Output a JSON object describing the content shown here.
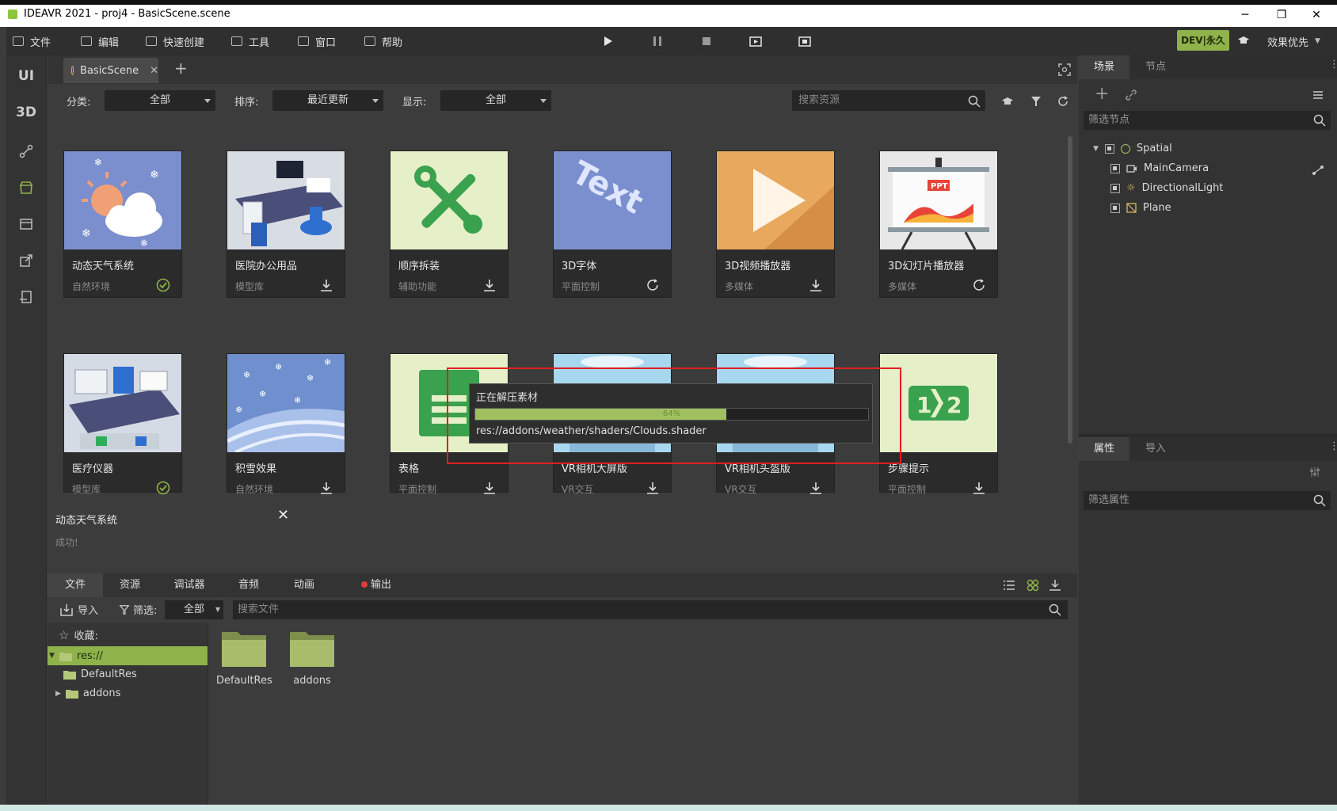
{
  "window": {
    "title": "IDEAVR 2021 - proj4 - BasicScene.scene",
    "controls": [
      "─",
      "❐",
      "✕"
    ]
  },
  "menu": {
    "items": [
      {
        "label": "文件",
        "icon": "folder-icon"
      },
      {
        "label": "编辑",
        "icon": "crop-icon"
      },
      {
        "label": "快速创建",
        "icon": "edit-icon"
      },
      {
        "label": "工具",
        "icon": "toolbox-icon"
      },
      {
        "label": "窗口",
        "icon": "window-icon"
      },
      {
        "label": "帮助",
        "icon": "book-icon"
      }
    ],
    "dev_badge": "DEV|永久",
    "quality": "效果优先"
  },
  "leftbar": {
    "ui": "UI",
    "threed": "3D"
  },
  "scene_tab": {
    "label": "BasicScene",
    "close": "✕",
    "add": "+"
  },
  "filters": {
    "category_label": "分类:",
    "category_value": "全部",
    "sort_label": "排序:",
    "sort_value": "最近更新",
    "display_label": "显示:",
    "display_value": "全部",
    "search_placeholder": "搜索资源"
  },
  "assets": [
    {
      "name": "动态天气系统",
      "category": "自然环境",
      "status": "installed"
    },
    {
      "name": "医院办公用品",
      "category": "模型库",
      "status": "download"
    },
    {
      "name": "顺序拆装",
      "category": "辅助功能",
      "status": "download"
    },
    {
      "name": "3D字体",
      "category": "平面控制",
      "status": "update"
    },
    {
      "name": "3D视频播放器",
      "category": "多媒体",
      "status": "download"
    },
    {
      "name": "3D幻灯片播放器",
      "category": "多媒体",
      "status": "update"
    },
    {
      "name": "医疗仪器",
      "category": "模型库",
      "status": "installed"
    },
    {
      "name": "积雪效果",
      "category": "自然环境",
      "status": "download"
    },
    {
      "name": "表格",
      "category": "平面控制",
      "status": "download"
    },
    {
      "name": "VR相机大屏版",
      "category": "VR交互",
      "status": "download"
    },
    {
      "name": "VR相机头盔版",
      "category": "VR交互",
      "status": "download"
    },
    {
      "name": "步骤提示",
      "category": "平面控制",
      "status": "download"
    }
  ],
  "thumb_text": {
    "text_art": "Text",
    "ppt": "PPT",
    "steps_left": "1",
    "steps_right": "2"
  },
  "notification": {
    "title": "动态天气系统",
    "message": "成功!",
    "close": "✕"
  },
  "progress": {
    "title": "正在解压素材",
    "percent_label": "64%",
    "fraction": 0.64,
    "path": "res://addons/weather/shaders/Clouds.shader"
  },
  "bottom": {
    "tabs": [
      "文件",
      "资源",
      "调试器",
      "音频",
      "动画",
      "输出"
    ],
    "import_label": "导入",
    "filter_label": "筛选:",
    "filter_value": "全部",
    "search_placeholder": "搜索文件",
    "favorites": "收藏:",
    "tree": [
      "res://",
      "DefaultRes",
      "addons"
    ],
    "folders": [
      "DefaultRes",
      "addons"
    ]
  },
  "right": {
    "tabs": [
      "场景",
      "节点"
    ],
    "filter_nodes": "筛选节点",
    "nodes": [
      "Spatial",
      "MainCamera",
      "DirectionalLight",
      "Plane"
    ],
    "prop_tabs": [
      "属性",
      "导入"
    ],
    "filter_props": "筛选属性"
  },
  "colors": {
    "accent": "#8fb24a",
    "progress_fill": "#a0c060",
    "highlight_box": "#e02020"
  }
}
